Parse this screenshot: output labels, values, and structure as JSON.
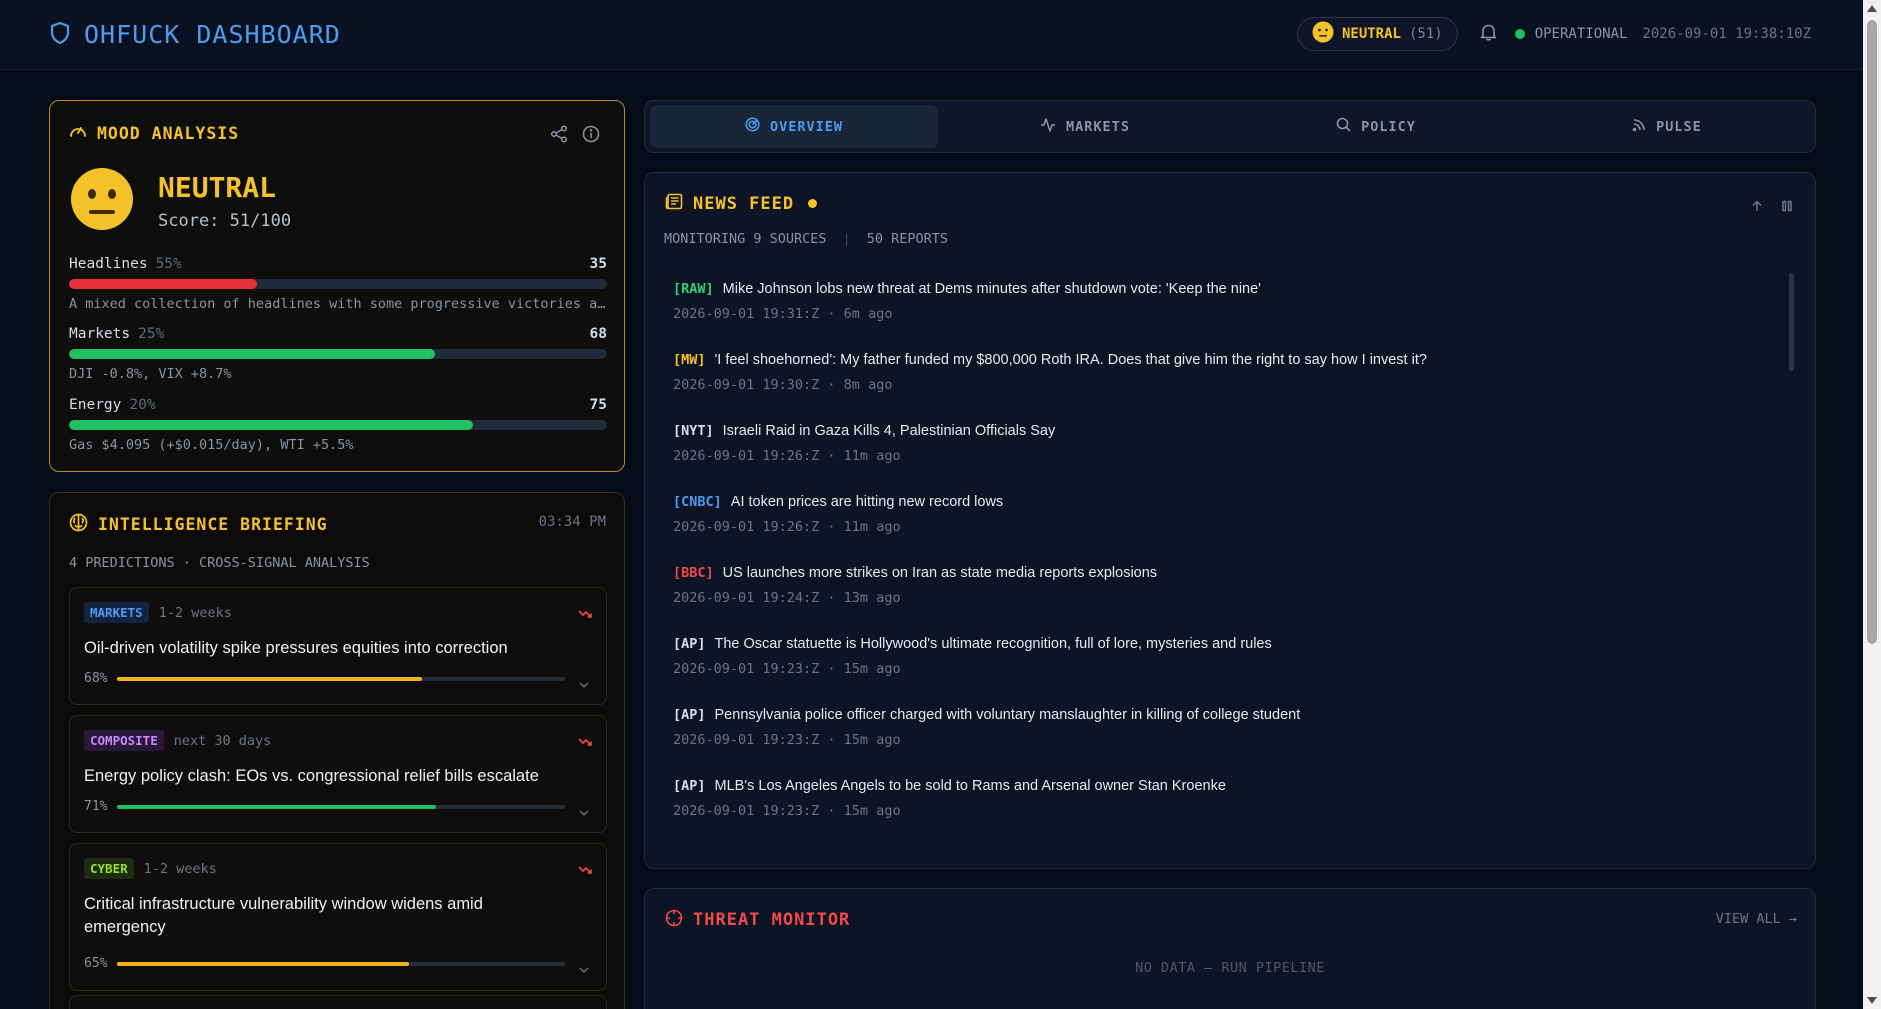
{
  "header": {
    "title": "OHFUCK DASHBOARD",
    "mood_label": "NEUTRAL",
    "mood_score": "(51)",
    "status": "OPERATIONAL",
    "timestamp": "2026-09-01 19:38:10Z"
  },
  "mood": {
    "title": "MOOD ANALYSIS",
    "label": "NEUTRAL",
    "score": "Score: 51/100",
    "metrics": [
      {
        "name": "Headlines",
        "weight": "55%",
        "value": "35",
        "fill": 0.35,
        "color": "#e8303a",
        "desc": "A mixed collection of headlines with some progressive victories and some concerning developments"
      },
      {
        "name": "Markets",
        "weight": "25%",
        "value": "68",
        "fill": 0.68,
        "color": "#21c15f",
        "desc": "DJI -0.8%, VIX +8.7%"
      },
      {
        "name": "Energy",
        "weight": "20%",
        "value": "75",
        "fill": 0.75,
        "color": "#21c15f",
        "desc": "Gas $4.095 (+$0.015/day), WTI +5.5%"
      }
    ]
  },
  "briefing": {
    "title": "INTELLIGENCE BRIEFING",
    "time": "03:34 PM",
    "subtitle": "4 PREDICTIONS · CROSS-SIGNAL ANALYSIS",
    "predictions": [
      {
        "tag": "MARKETS",
        "tag_color": "#4f9bf0",
        "tag_bg": "#14233f",
        "horizon": "1-2 weeks",
        "text": "Oil-driven volatility spike pressures equities into correction",
        "confidence": "68%",
        "fill": 0.68,
        "bar_color": "#f0b41e"
      },
      {
        "tag": "COMPOSITE",
        "tag_color": "#c58af5",
        "tag_bg": "#2a1838",
        "horizon": "next 30 days",
        "text": "Energy policy clash: EOs vs. congressional relief bills escalate",
        "confidence": "71%",
        "fill": 0.71,
        "bar_color": "#21c15f"
      },
      {
        "tag": "CYBER",
        "tag_color": "#9ae033",
        "tag_bg": "#1f2c12",
        "horizon": "1-2 weeks",
        "text": "Critical infrastructure vulnerability window widens amid emergency",
        "confidence": "65%",
        "fill": 0.65,
        "bar_color": "#f0b41e"
      }
    ]
  },
  "tabs": [
    {
      "label": "OVERVIEW",
      "icon": "radar-icon",
      "active": true
    },
    {
      "label": "MARKETS",
      "icon": "activity-icon",
      "active": false
    },
    {
      "label": "POLICY",
      "icon": "search-icon",
      "active": false
    },
    {
      "label": "PULSE",
      "icon": "rss-icon",
      "active": false
    }
  ],
  "news": {
    "title": "NEWS FEED",
    "sources": "MONITORING 9 SOURCES",
    "reports": "50 REPORTS",
    "items": [
      {
        "src": "[RAW]",
        "color": "#2ed27a",
        "headline": "Mike Johnson lobs new threat at Dems minutes after shutdown vote: 'Keep the nine'",
        "meta": "2026-09-01 19:31:Z · 6m ago"
      },
      {
        "src": "[MW]",
        "color": "#f6c22b",
        "headline": "'I feel shoehorned': My father funded my $800,000 Roth IRA. Does that give him the right to say how I invest it?",
        "meta": "2026-09-01 19:30:Z · 8m ago"
      },
      {
        "src": "[NYT]",
        "color": "#d7dde8",
        "headline": "Israeli Raid in Gaza Kills 4, Palestinian Officials Say",
        "meta": "2026-09-01 19:26:Z · 11m ago"
      },
      {
        "src": "[CNBC]",
        "color": "#4f9bf0",
        "headline": "AI token prices are hitting new record lows",
        "meta": "2026-09-01 19:26:Z · 11m ago"
      },
      {
        "src": "[BBC]",
        "color": "#f04a4a",
        "headline": "US launches more strikes on Iran as state media reports explosions",
        "meta": "2026-09-01 19:24:Z · 13m ago"
      },
      {
        "src": "[AP]",
        "color": "#d7dde8",
        "headline": "The Oscar statuette is Hollywood's ultimate recognition, full of lore, mysteries and rules",
        "meta": "2026-09-01 19:23:Z · 15m ago"
      },
      {
        "src": "[AP]",
        "color": "#d7dde8",
        "headline": "Pennsylvania police officer charged with voluntary manslaughter in killing of college student",
        "meta": "2026-09-01 19:23:Z · 15m ago"
      },
      {
        "src": "[AP]",
        "color": "#d7dde8",
        "headline": "MLB's Los Angeles Angels to be sold to Rams and Arsenal owner Stan Kroenke",
        "meta": "2026-09-01 19:23:Z · 15m ago"
      }
    ]
  },
  "threat": {
    "title": "THREAT MONITOR",
    "view_all": "VIEW ALL →",
    "empty": "NO DATA — RUN PIPELINE"
  }
}
